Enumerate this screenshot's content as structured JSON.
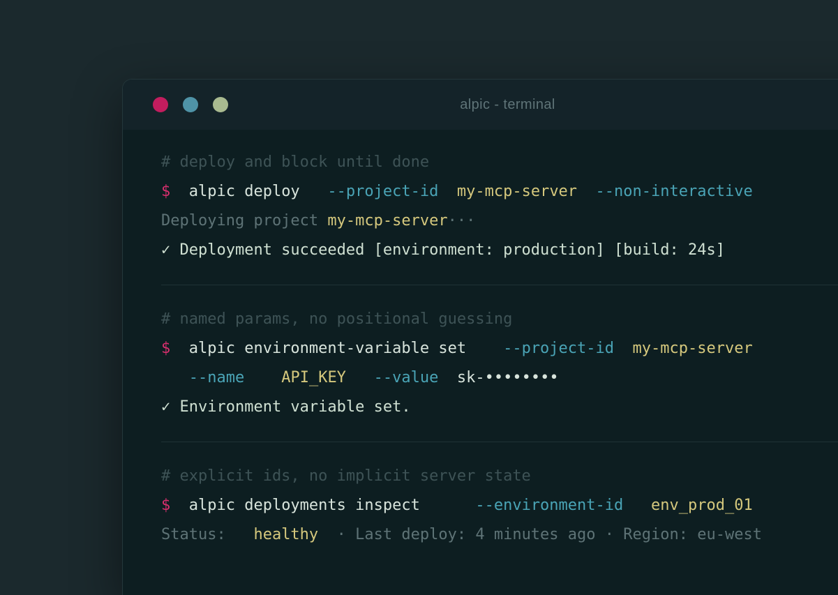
{
  "colors": {
    "page-bg": "#1b292d",
    "titlebar-bg": "#142329",
    "terminal-bg": "#0d1e21",
    "window-border": "#24373b",
    "divider": "#1f3236",
    "title-text": "#5f7478",
    "dot-close": "#c21d5e",
    "dot-minimize": "#4f93a7",
    "dot-zoom": "#a9ba90",
    "comment": "#3e5356",
    "prompt": "#d62f6d",
    "base": "#d8e4dc",
    "flag": "#4aa4b6",
    "value": "#d5c87d",
    "muted": "#5e7376",
    "success": "#cfe0d2"
  },
  "window": {
    "title": "alpic - terminal"
  },
  "terminal": {
    "lines": [
      {
        "type": "comment-line",
        "segments": [
          {
            "style": "comment",
            "text": "# deploy and block until done"
          }
        ]
      },
      {
        "type": "command-line",
        "segments": [
          {
            "style": "prompt",
            "text": "$"
          },
          {
            "style": "base",
            "text": "  alpic deploy   "
          },
          {
            "style": "flag",
            "text": "--project-id"
          },
          {
            "style": "value",
            "text": "  my-mcp-server"
          },
          {
            "style": "flag",
            "text": "  --non-interactive"
          }
        ]
      },
      {
        "type": "output-line",
        "segments": [
          {
            "style": "muted",
            "text": "Deploying project "
          },
          {
            "style": "value",
            "text": "my-mcp-server"
          },
          {
            "style": "muted",
            "text": "···"
          }
        ]
      },
      {
        "type": "output-line",
        "segments": [
          {
            "style": "success",
            "text": "✓ Deployment succeeded [environment: production] [build: 24s]"
          }
        ]
      },
      {
        "type": "divider"
      },
      {
        "type": "comment-line",
        "segments": [
          {
            "style": "comment",
            "text": "# named params, no positional guessing"
          }
        ]
      },
      {
        "type": "command-line",
        "segments": [
          {
            "style": "prompt",
            "text": "$"
          },
          {
            "style": "base",
            "text": "  alpic environment-variable set    "
          },
          {
            "style": "flag",
            "text": "--project-id"
          },
          {
            "style": "value",
            "text": "  my-mcp-server"
          }
        ]
      },
      {
        "type": "command-line",
        "segments": [
          {
            "style": "base",
            "text": "   "
          },
          {
            "style": "flag",
            "text": "--name"
          },
          {
            "style": "value",
            "text": "    API_KEY"
          },
          {
            "style": "flag",
            "text": "   --value"
          },
          {
            "style": "base",
            "text": "  sk-••••••••"
          }
        ]
      },
      {
        "type": "output-line",
        "segments": [
          {
            "style": "success",
            "text": "✓ Environment variable set."
          }
        ]
      },
      {
        "type": "divider"
      },
      {
        "type": "comment-line",
        "segments": [
          {
            "style": "comment",
            "text": "# explicit ids, no implicit server state"
          }
        ]
      },
      {
        "type": "command-line",
        "segments": [
          {
            "style": "prompt",
            "text": "$"
          },
          {
            "style": "base",
            "text": "  alpic deployments inspect      "
          },
          {
            "style": "flag",
            "text": "--environment-id"
          },
          {
            "style": "value",
            "text": "   env_prod_01"
          }
        ]
      },
      {
        "type": "output-line",
        "segments": [
          {
            "style": "muted",
            "text": "Status:   "
          },
          {
            "style": "value",
            "text": "healthy"
          },
          {
            "style": "muted",
            "text": "  · Last deploy: 4 minutes ago · Region: eu-west"
          }
        ]
      }
    ]
  }
}
